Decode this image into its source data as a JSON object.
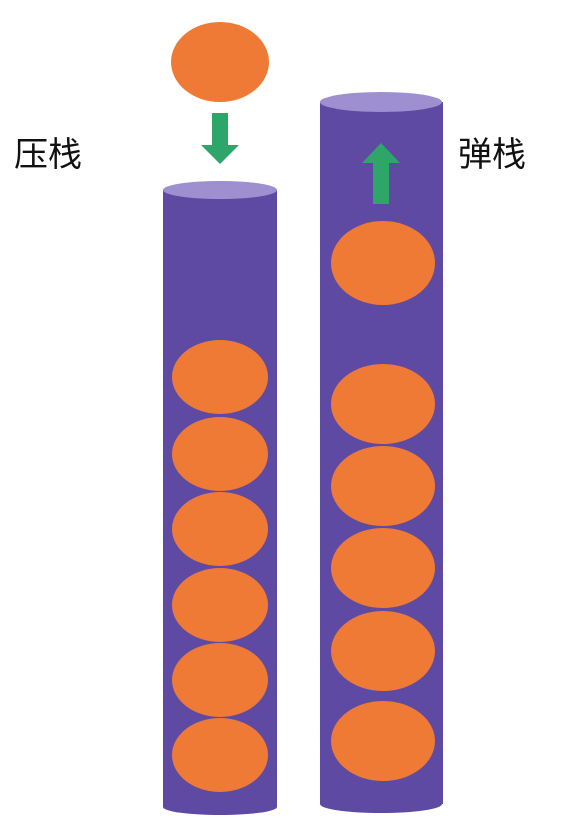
{
  "labels": {
    "push": "压栈",
    "pop": "弹栈"
  },
  "colors": {
    "tube": "#5e4aa3",
    "tube_top": "#9d8fd0",
    "ball": "#ee7a35",
    "arrow": "#2ea66a",
    "background": "#ffffff"
  },
  "stacks": [
    {
      "id": "push-stack",
      "items_inside": 6,
      "incoming_ball": true,
      "arrow": "down"
    },
    {
      "id": "pop-stack",
      "items_inside": 5,
      "outgoing_ball": true,
      "arrow": "up"
    }
  ]
}
